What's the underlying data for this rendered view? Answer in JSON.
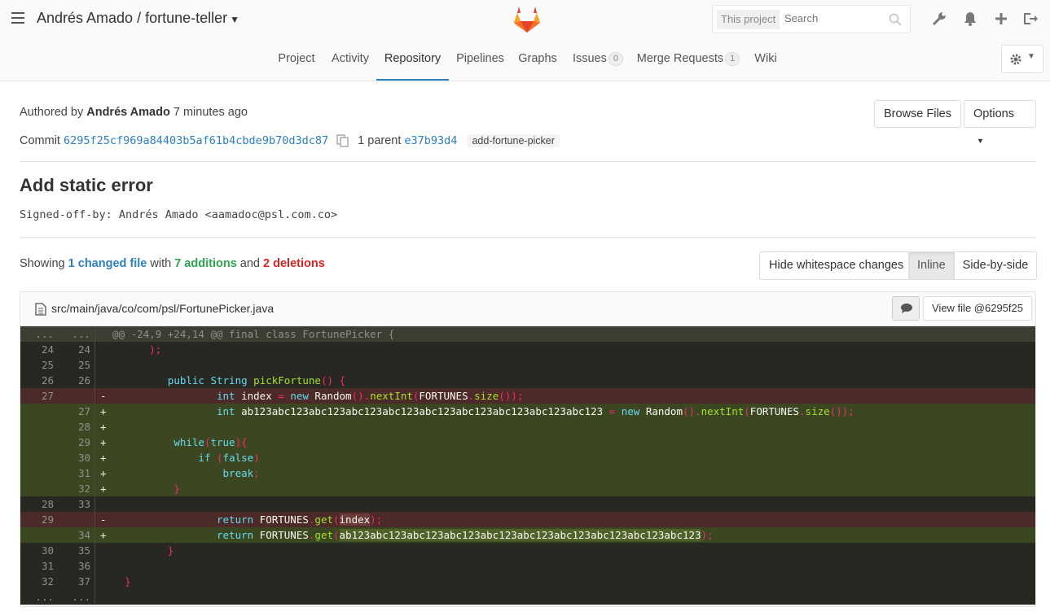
{
  "header": {
    "project_title": "Andrés Amado / fortune-teller",
    "search_scope": "This project",
    "search_placeholder": "Search"
  },
  "nav": {
    "tabs": [
      {
        "label": "Project"
      },
      {
        "label": "Activity"
      },
      {
        "label": "Repository"
      },
      {
        "label": "Pipelines"
      },
      {
        "label": "Graphs"
      },
      {
        "label": "Issues",
        "count": "0"
      },
      {
        "label": "Merge Requests",
        "count": "1"
      },
      {
        "label": "Wiki"
      }
    ],
    "active": "Repository"
  },
  "commit": {
    "authored_prefix": "Authored by",
    "author": "Andrés Amado",
    "time_ago": "7 minutes ago",
    "commit_label": "Commit",
    "sha": "6295f25cf969a84403b5af61b4cbde9b70d3dc87",
    "parent_label": "1 parent",
    "parent_sha": "e37b93d4",
    "branch": "add-fortune-picker",
    "title": "Add static error",
    "description": "Signed-off-by: Andrés Amado <aamadoc@psl.com.co>",
    "browse_files": "Browse Files",
    "options": "Options"
  },
  "summary": {
    "showing": "Showing",
    "changed_files": "1 changed file",
    "with": "with",
    "additions": "7 additions",
    "and": "and",
    "deletions": "2 deletions"
  },
  "view_controls": {
    "hide_whitespace": "Hide whitespace changes",
    "inline": "Inline",
    "side_by_side": "Side-by-side"
  },
  "file": {
    "path": "src/main/java/co/com/psl/FortunePicker.java",
    "view_file": "View file @6295f25"
  },
  "diff_lines": [
    {
      "type": "match",
      "old": "...",
      "new": "...",
      "sign": "",
      "code": "@@ -24,9 +24,14 @@ final class FortunePicker {"
    },
    {
      "type": "ctx",
      "old": "24",
      "new": "24",
      "sign": "",
      "code": "      );"
    },
    {
      "type": "ctx",
      "old": "25",
      "new": "25",
      "sign": "",
      "code": ""
    },
    {
      "type": "ctx",
      "old": "26",
      "new": "26",
      "sign": "",
      "code": "         public String pickFortune() {"
    },
    {
      "type": "old",
      "old": "27",
      "new": "",
      "sign": "-",
      "code": "                 int index = new Random().nextInt(FORTUNES.size());"
    },
    {
      "type": "new",
      "old": "",
      "new": "27",
      "sign": "+",
      "code": "                 int ab123abc123abc123abc123abc123abc123abc123abc123abc123abc123 = new Random().nextInt(FORTUNES.size());"
    },
    {
      "type": "new",
      "old": "",
      "new": "28",
      "sign": "+",
      "code": ""
    },
    {
      "type": "new",
      "old": "",
      "new": "29",
      "sign": "+",
      "code": "          while(true){"
    },
    {
      "type": "new",
      "old": "",
      "new": "30",
      "sign": "+",
      "code": "              if (false)"
    },
    {
      "type": "new",
      "old": "",
      "new": "31",
      "sign": "+",
      "code": "                  break;"
    },
    {
      "type": "new",
      "old": "",
      "new": "32",
      "sign": "+",
      "code": "          }"
    },
    {
      "type": "ctx",
      "old": "28",
      "new": "33",
      "sign": "",
      "code": ""
    },
    {
      "type": "old",
      "old": "29",
      "new": "",
      "sign": "-",
      "code": "                 return FORTUNES.get(index);"
    },
    {
      "type": "new",
      "old": "",
      "new": "34",
      "sign": "+",
      "code": "                 return FORTUNES.get(ab123abc123abc123abc123abc123abc123abc123abc123abc123abc123);"
    },
    {
      "type": "ctx",
      "old": "30",
      "new": "35",
      "sign": "",
      "code": "         }"
    },
    {
      "type": "ctx",
      "old": "31",
      "new": "36",
      "sign": "",
      "code": ""
    },
    {
      "type": "ctx",
      "old": "32",
      "new": "37",
      "sign": "",
      "code": "  }"
    },
    {
      "type": "ctx",
      "old": "...",
      "new": "...",
      "sign": "",
      "code": ""
    }
  ]
}
